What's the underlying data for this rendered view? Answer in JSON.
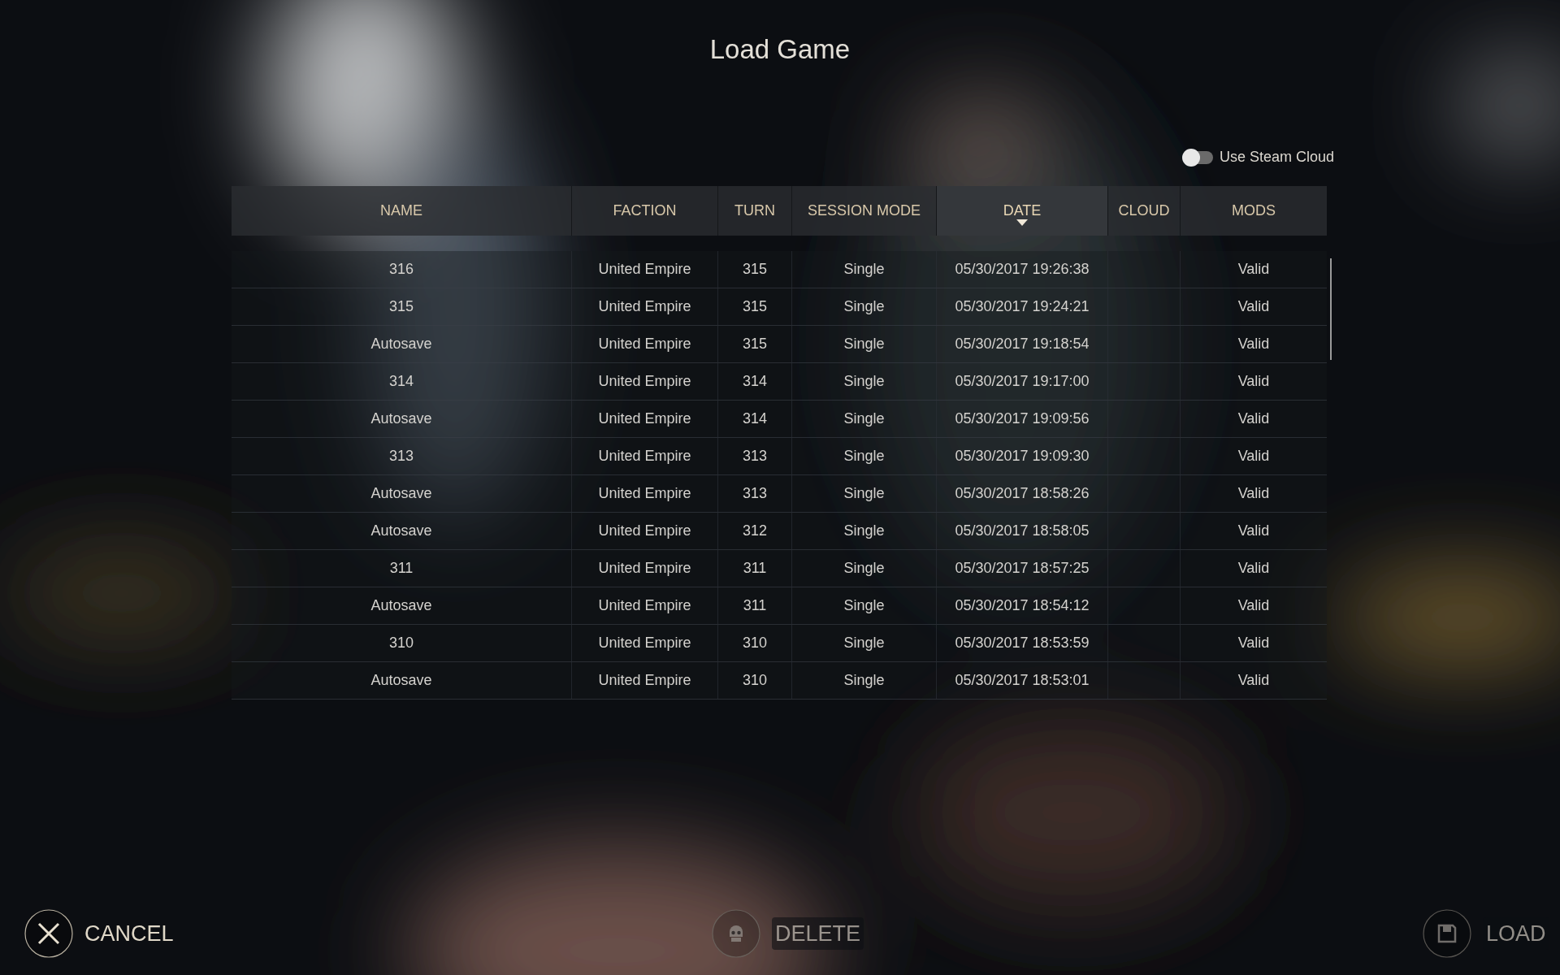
{
  "title": "Load Game",
  "steam_cloud": {
    "label": "Use Steam Cloud",
    "on": false
  },
  "columns": [
    {
      "label": "NAME",
      "sorted": false
    },
    {
      "label": "FACTION",
      "sorted": false
    },
    {
      "label": "TURN",
      "sorted": false
    },
    {
      "label": "SESSION MODE",
      "sorted": false
    },
    {
      "label": "DATE",
      "sorted": true
    },
    {
      "label": "CLOUD",
      "sorted": false
    },
    {
      "label": "MODS",
      "sorted": false
    }
  ],
  "rows": [
    {
      "name": "316",
      "faction": "United Empire",
      "turn": "315",
      "mode": "Single",
      "date": "05/30/2017 19:26:38",
      "mods": "Valid"
    },
    {
      "name": "315",
      "faction": "United Empire",
      "turn": "315",
      "mode": "Single",
      "date": "05/30/2017 19:24:21",
      "mods": "Valid"
    },
    {
      "name": "Autosave",
      "faction": "United Empire",
      "turn": "315",
      "mode": "Single",
      "date": "05/30/2017 19:18:54",
      "mods": "Valid"
    },
    {
      "name": "314",
      "faction": "United Empire",
      "turn": "314",
      "mode": "Single",
      "date": "05/30/2017 19:17:00",
      "mods": "Valid"
    },
    {
      "name": "Autosave",
      "faction": "United Empire",
      "turn": "314",
      "mode": "Single",
      "date": "05/30/2017 19:09:56",
      "mods": "Valid"
    },
    {
      "name": "313",
      "faction": "United Empire",
      "turn": "313",
      "mode": "Single",
      "date": "05/30/2017 19:09:30",
      "mods": "Valid"
    },
    {
      "name": "Autosave",
      "faction": "United Empire",
      "turn": "313",
      "mode": "Single",
      "date": "05/30/2017 18:58:26",
      "mods": "Valid"
    },
    {
      "name": "Autosave",
      "faction": "United Empire",
      "turn": "312",
      "mode": "Single",
      "date": "05/30/2017 18:58:05",
      "mods": "Valid"
    },
    {
      "name": "311",
      "faction": "United Empire",
      "turn": "311",
      "mode": "Single",
      "date": "05/30/2017 18:57:25",
      "mods": "Valid"
    },
    {
      "name": "Autosave",
      "faction": "United Empire",
      "turn": "311",
      "mode": "Single",
      "date": "05/30/2017 18:54:12",
      "mods": "Valid"
    },
    {
      "name": "310",
      "faction": "United Empire",
      "turn": "310",
      "mode": "Single",
      "date": "05/30/2017 18:53:59",
      "mods": "Valid"
    },
    {
      "name": "Autosave",
      "faction": "United Empire",
      "turn": "310",
      "mode": "Single",
      "date": "05/30/2017 18:53:01",
      "mods": "Valid"
    }
  ],
  "buttons": [
    {
      "kind": "cancel",
      "label": "CANCEL",
      "disabled": false
    },
    {
      "kind": "delete",
      "label": "DELETE",
      "disabled": true
    },
    {
      "kind": "load",
      "label": "LOAD",
      "disabled": true
    }
  ]
}
